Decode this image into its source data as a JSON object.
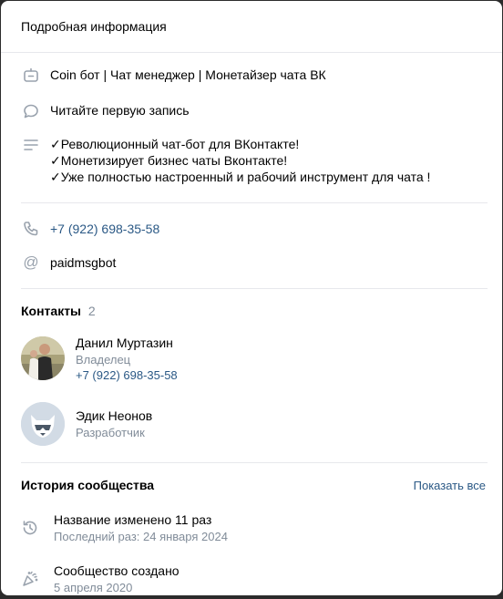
{
  "header": {
    "title": "Подробная информация"
  },
  "info": {
    "name": "Coin бот | Чат менеджер | Монетайзер чата ВК",
    "status": "Читайте первую запись",
    "description_lines": [
      "✓Революционный чат-бот для ВКонтакте!",
      "✓Монетизирует бизнес чаты Вконтакте!",
      "✓Уже полностью настроенный и рабочий инструмент для чата !"
    ],
    "phone": "+7 (922) 698-35-58",
    "username": "paidmsgbot"
  },
  "contacts": {
    "title": "Контакты",
    "count": "2",
    "items": [
      {
        "name": "Данил Муртазин",
        "role": "Владелец",
        "phone": "+7 (922) 698-35-58"
      },
      {
        "name": "Эдик Неонов",
        "role": "Разработчик"
      }
    ]
  },
  "history": {
    "title": "История сообщества",
    "show_all": "Показать все",
    "items": [
      {
        "title": "Название изменено 11 раз",
        "subtitle": "Последний раз: 24 января 2024"
      },
      {
        "title": "Сообщество создано",
        "subtitle": "5 апреля 2020"
      }
    ]
  },
  "colors": {
    "link": "#2a5885",
    "muted": "#818c99",
    "icon": "#99a2ad",
    "divider": "#e7e8ec"
  }
}
